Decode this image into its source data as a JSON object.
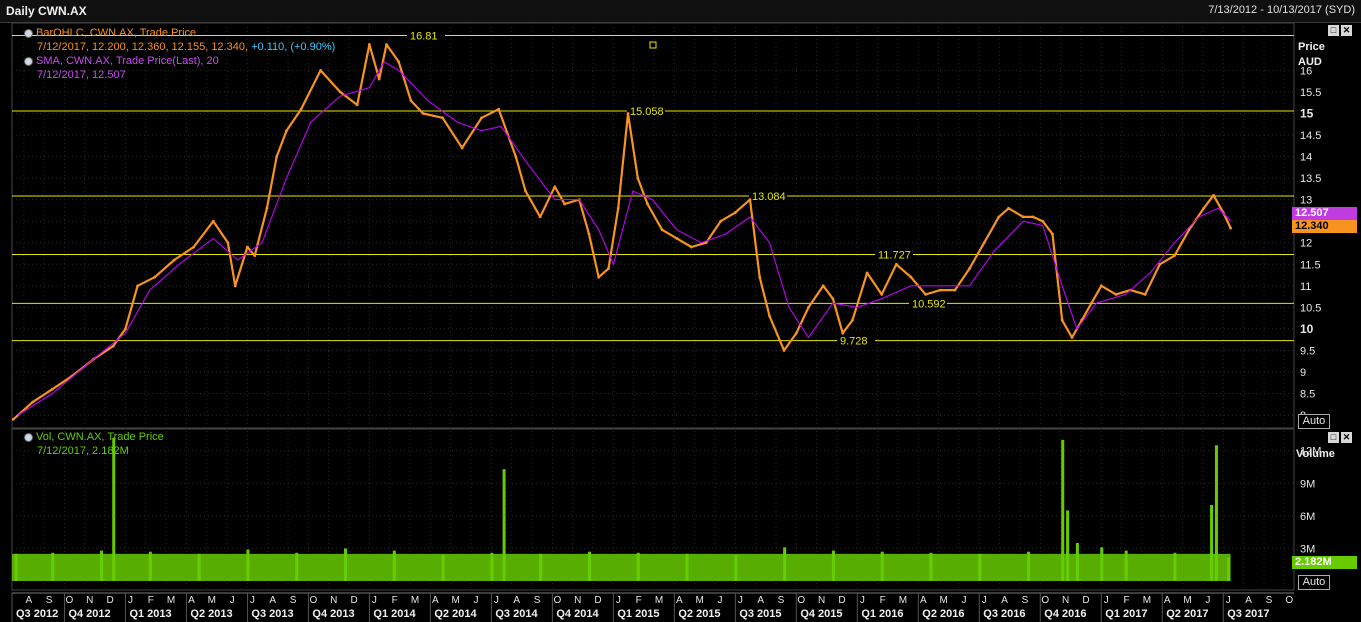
{
  "window": {
    "title": "Daily CWN.AX",
    "date_range": "7/13/2012 - 10/13/2017 (SYD)"
  },
  "price_panel": {
    "legend_bar_title": "BarOHLC, CWN.AX, Trade Price",
    "legend_bar_values": "7/12/2017, 12.200, 12.360, 12.155, 12.340,",
    "legend_bar_change": "+0.110, (+0.90%)",
    "legend_sma_title": "SMA, CWN.AX, Trade Price(Last),  20",
    "legend_sma_values": "7/12/2017, 12.507",
    "axis_title": "Price",
    "axis_unit": "AUD",
    "auto_label": "Auto",
    "last_sma_tag": "12.507",
    "last_price_tag": "12.340"
  },
  "volume_panel": {
    "legend_title": "Vol, CWN.AX, Trade Price",
    "legend_values": "7/12/2017, 2.182M",
    "axis_title": "Volume",
    "auto_label": "Auto",
    "last_volume_tag": "2.182M"
  },
  "icons": [
    "restore-window-icon",
    "close-window-icon",
    "legend-knob-icon",
    "anchor-square-icon"
  ],
  "colors": {
    "background": "#000000",
    "price_bars": "#f7931e",
    "sma_line": "#c000ff",
    "horizontal_lines": "#e6e600",
    "volume_bars": "#66cc00",
    "sma_tag": "#c03ce0",
    "price_tag": "#f7931e"
  },
  "chart_data": [
    {
      "type": "line",
      "title": "Daily CWN.AX",
      "ylabel": "Price",
      "yunit": "AUD",
      "ylim": [
        7.7,
        17.1
      ],
      "y_ticks": [
        "8",
        "8.5",
        "9",
        "9.5",
        "10",
        "10.5",
        "11",
        "11.5",
        "12",
        "12.5",
        "13",
        "13.5",
        "14",
        "14.5",
        "15",
        "15.5",
        "16"
      ],
      "y_tick_values": [
        8,
        8.5,
        9,
        9.5,
        10,
        10.5,
        11,
        11.5,
        12,
        12.5,
        13,
        13.5,
        14,
        14.5,
        15,
        15.5,
        16
      ],
      "bold_ticks": [
        "10",
        "15"
      ],
      "x_month_ticks": [
        "A",
        "S",
        "O",
        "N",
        "D",
        "J",
        "F",
        "M",
        "A",
        "M",
        "J",
        "J",
        "A",
        "S",
        "O",
        "N",
        "D",
        "J",
        "F",
        "M",
        "A",
        "M",
        "J",
        "J",
        "A",
        "S",
        "O",
        "N",
        "D",
        "J",
        "F",
        "M",
        "A",
        "M",
        "J",
        "J",
        "A",
        "S",
        "O",
        "N",
        "D",
        "J",
        "F",
        "M",
        "A",
        "M",
        "J",
        "J",
        "A",
        "S",
        "O",
        "N",
        "D",
        "J",
        "F",
        "M",
        "A",
        "M",
        "J",
        "J",
        "A",
        "S",
        "O"
      ],
      "x_quarter_ticks": [
        "Q3 2012",
        "Q4 2012",
        "Q1 2013",
        "Q2 2013",
        "Q3 2013",
        "Q4 2013",
        "Q1 2014",
        "Q2 2014",
        "Q3 2014",
        "Q4 2014",
        "Q1 2015",
        "Q2 2015",
        "Q3 2015",
        "Q4 2015",
        "Q1 2016",
        "Q2 2016",
        "Q3 2016",
        "Q4 2016",
        "Q1 2017",
        "Q2 2017",
        "Q3 2017"
      ],
      "horizontal_lines": [
        {
          "value": 16.81,
          "label": "16.81"
        },
        {
          "value": 15.058,
          "label": "15.058"
        },
        {
          "value": 13.084,
          "label": "13.084"
        },
        {
          "value": 11.727,
          "label": "11.727"
        },
        {
          "value": 10.592,
          "label": "10.592"
        },
        {
          "value": 9.728,
          "label": "9.728"
        }
      ],
      "series": [
        {
          "name": "BarOHLC, CWN.AX, Trade Price",
          "x": [
            2012.54,
            2012.62,
            2012.7,
            2012.78,
            2012.87,
            2012.95,
            2013.0,
            2013.05,
            2013.12,
            2013.2,
            2013.28,
            2013.36,
            2013.42,
            2013.45,
            2013.5,
            2013.53,
            2013.58,
            2013.62,
            2013.66,
            2013.72,
            2013.8,
            2013.88,
            2013.95,
            2014.0,
            2014.04,
            2014.07,
            2014.12,
            2014.17,
            2014.22,
            2014.3,
            2014.38,
            2014.46,
            2014.53,
            2014.6,
            2014.64,
            2014.7,
            2014.76,
            2014.8,
            2014.86,
            2014.9,
            2014.94,
            2014.98,
            2015.02,
            2015.06,
            2015.1,
            2015.14,
            2015.2,
            2015.26,
            2015.32,
            2015.38,
            2015.44,
            2015.5,
            2015.56,
            2015.6,
            2015.64,
            2015.7,
            2015.75,
            2015.8,
            2015.86,
            2015.9,
            2015.94,
            2015.98,
            2016.04,
            2016.1,
            2016.16,
            2016.22,
            2016.28,
            2016.34,
            2016.4,
            2016.46,
            2016.52,
            2016.58,
            2016.62,
            2016.68,
            2016.72,
            2016.76,
            2016.8,
            2016.84,
            2016.88,
            2016.92,
            2016.96,
            2017.0,
            2017.06,
            2017.12,
            2017.18,
            2017.24,
            2017.3,
            2017.36,
            2017.42,
            2017.46,
            2017.5,
            2017.53
          ],
          "y": [
            7.9,
            8.3,
            8.6,
            8.9,
            9.3,
            9.6,
            10.0,
            11.0,
            11.2,
            11.6,
            11.9,
            12.5,
            12.0,
            11.0,
            11.9,
            11.7,
            12.8,
            14.0,
            14.6,
            15.1,
            16.0,
            15.5,
            15.2,
            16.6,
            15.8,
            16.6,
            16.2,
            15.3,
            15.0,
            14.9,
            14.2,
            14.9,
            15.1,
            14.0,
            13.2,
            12.6,
            13.3,
            12.9,
            13.0,
            12.2,
            11.2,
            11.4,
            12.8,
            15.0,
            13.5,
            12.9,
            12.3,
            12.1,
            11.9,
            12.0,
            12.5,
            12.7,
            13.0,
            11.2,
            10.3,
            9.5,
            9.9,
            10.5,
            11.0,
            10.7,
            9.9,
            10.2,
            11.3,
            10.8,
            11.5,
            11.2,
            10.8,
            10.9,
            10.9,
            11.4,
            12.0,
            12.6,
            12.8,
            12.6,
            12.6,
            12.5,
            12.2,
            10.2,
            9.8,
            10.2,
            10.6,
            11.0,
            10.8,
            10.9,
            10.8,
            11.5,
            11.7,
            12.3,
            12.8,
            13.1,
            12.7,
            12.34
          ]
        },
        {
          "name": "SMA, CWN.AX, Trade Price(Last),  20",
          "x": [
            2012.56,
            2012.7,
            2012.87,
            2013.0,
            2013.1,
            2013.22,
            2013.36,
            2013.46,
            2013.56,
            2013.66,
            2013.76,
            2013.88,
            2014.0,
            2014.06,
            2014.12,
            2014.24,
            2014.36,
            2014.46,
            2014.54,
            2014.64,
            2014.76,
            2014.86,
            2014.94,
            2015.0,
            2015.08,
            2015.16,
            2015.26,
            2015.36,
            2015.46,
            2015.56,
            2015.64,
            2015.72,
            2015.8,
            2015.9,
            2016.0,
            2016.1,
            2016.22,
            2016.34,
            2016.46,
            2016.56,
            2016.68,
            2016.76,
            2016.84,
            2016.9,
            2016.98,
            2017.1,
            2017.2,
            2017.3,
            2017.4,
            2017.48,
            2017.53
          ],
          "y": [
            8.0,
            8.5,
            9.3,
            9.9,
            10.9,
            11.5,
            12.1,
            11.6,
            12.0,
            13.5,
            14.8,
            15.4,
            15.6,
            16.2,
            16.0,
            15.3,
            14.8,
            14.6,
            14.7,
            13.9,
            13.0,
            13.0,
            12.3,
            11.5,
            13.2,
            13.0,
            12.3,
            12.0,
            12.2,
            12.6,
            12.0,
            10.5,
            9.8,
            10.6,
            10.5,
            10.7,
            11.0,
            11.0,
            11.0,
            11.8,
            12.5,
            12.4,
            11.0,
            10.0,
            10.6,
            10.8,
            11.3,
            12.0,
            12.6,
            12.8,
            12.507
          ]
        }
      ]
    },
    {
      "type": "bar",
      "title": "Vol, CWN.AX, Trade Price",
      "ylabel": "Volume",
      "ylim": [
        0,
        14000000
      ],
      "y_ticks": [
        "3M",
        "6M",
        "9M",
        "12M"
      ],
      "y_tick_values": [
        3000000,
        6000000,
        9000000,
        12000000
      ],
      "series": [
        {
          "name": "Vol, CWN.AX, Trade Price",
          "x": [
            2012.55,
            2012.7,
            2012.9,
            2012.95,
            2013.1,
            2013.3,
            2013.5,
            2013.7,
            2013.9,
            2014.1,
            2014.3,
            2014.5,
            2014.55,
            2014.7,
            2014.9,
            2015.1,
            2015.3,
            2015.5,
            2015.7,
            2015.9,
            2016.1,
            2016.3,
            2016.5,
            2016.7,
            2016.84,
            2016.86,
            2016.9,
            2017.0,
            2017.1,
            2017.3,
            2017.45,
            2017.47,
            2017.52
          ],
          "y": [
            2500000,
            2600000,
            2800000,
            13200000,
            2700000,
            2500000,
            2900000,
            2600000,
            3000000,
            2800000,
            2400000,
            2600000,
            10300000,
            2500000,
            2700000,
            2600000,
            2500000,
            2400000,
            3100000,
            2800000,
            2700000,
            2600000,
            2500000,
            2700000,
            13000000,
            6500000,
            3500000,
            3100000,
            2800000,
            2600000,
            7000000,
            12500000,
            2182000
          ]
        }
      ]
    }
  ]
}
